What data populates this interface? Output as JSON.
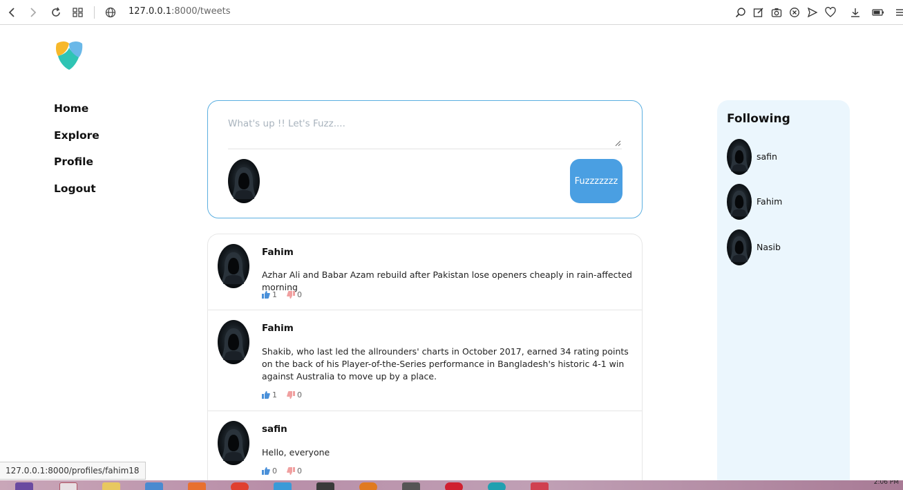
{
  "browser": {
    "url_host": "127.0.0.1",
    "url_path": ":8000/tweets"
  },
  "nav": {
    "items": [
      {
        "label": "Home"
      },
      {
        "label": "Explore"
      },
      {
        "label": "Profile"
      },
      {
        "label": "Logout"
      }
    ]
  },
  "composer": {
    "placeholder": "What's up !! Let's Fuzz....",
    "submit_label": "Fuzzzzzzz"
  },
  "tweets": [
    {
      "author": "Fahim",
      "text": "Azhar Ali and Babar Azam rebuild after Pakistan lose openers cheaply in rain-affected morning",
      "likes": "1",
      "dislikes": "0"
    },
    {
      "author": "Fahim",
      "text": "Shakib, who last led the allrounders' charts in October 2017, earned 34 rating points on the back of his Player-of-the-Series performance in Bangladesh's historic 4-1 win against Australia to move up by a place.",
      "likes": "1",
      "dislikes": "0"
    },
    {
      "author": "safin",
      "text": "Hello, everyone",
      "likes": "0",
      "dislikes": "0"
    }
  ],
  "following": {
    "title": "Following",
    "users": [
      {
        "name": "safin"
      },
      {
        "name": "Fahim"
      },
      {
        "name": "Nasib"
      }
    ]
  },
  "status_url": "127.0.0.1:8000/profiles/fahim18",
  "taskbar": {
    "clock": "2:06 PM"
  },
  "colors": {
    "accent": "#4a9fe2",
    "panel_bg": "#ebf6fd",
    "like": "#4a90d9",
    "dislike": "#f0a0a0"
  }
}
